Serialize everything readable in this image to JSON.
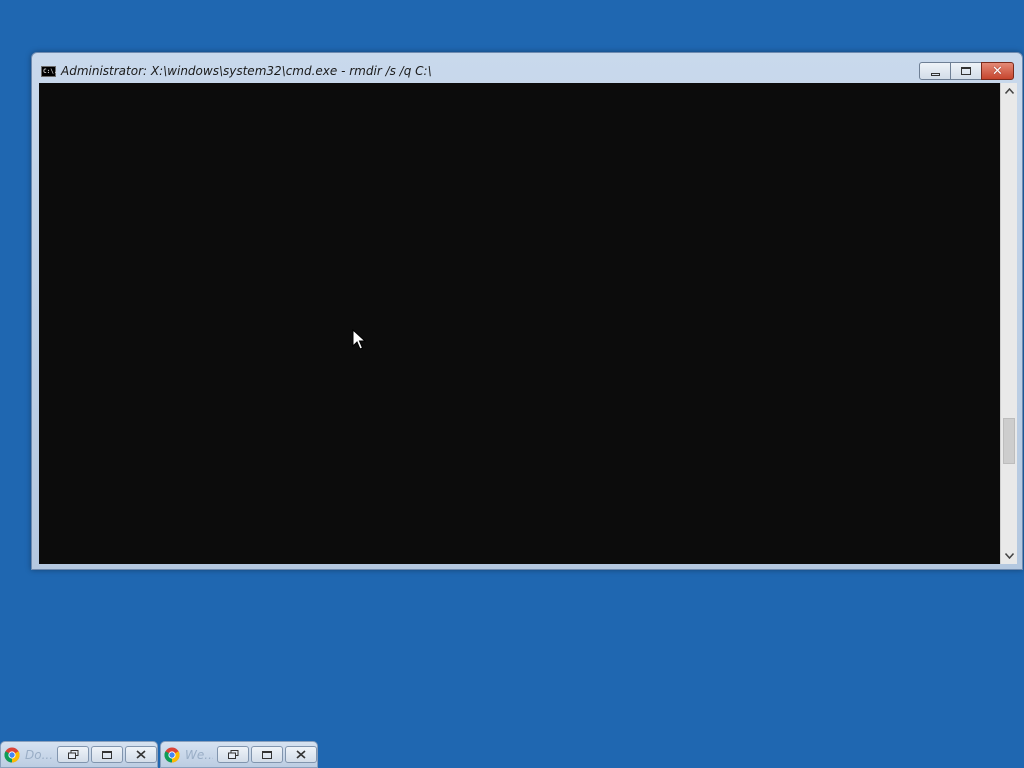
{
  "desktop": {
    "background_color": "#1f67b1"
  },
  "window": {
    "title": "Administrator: X:\\windows\\system32\\cmd.exe - rmdir  /s /q C:\\",
    "icon": "cmd-icon",
    "icon_text": "C:\\.",
    "console_background": "#0c0c0c",
    "buttons": {
      "minimize": "minimize-icon",
      "maximize": "maximize-icon",
      "close": "✕"
    }
  },
  "minimized_windows": [
    {
      "label": "Do...",
      "icon": "chrome-icon"
    },
    {
      "label": "We...",
      "icon": "chrome-icon"
    }
  ]
}
